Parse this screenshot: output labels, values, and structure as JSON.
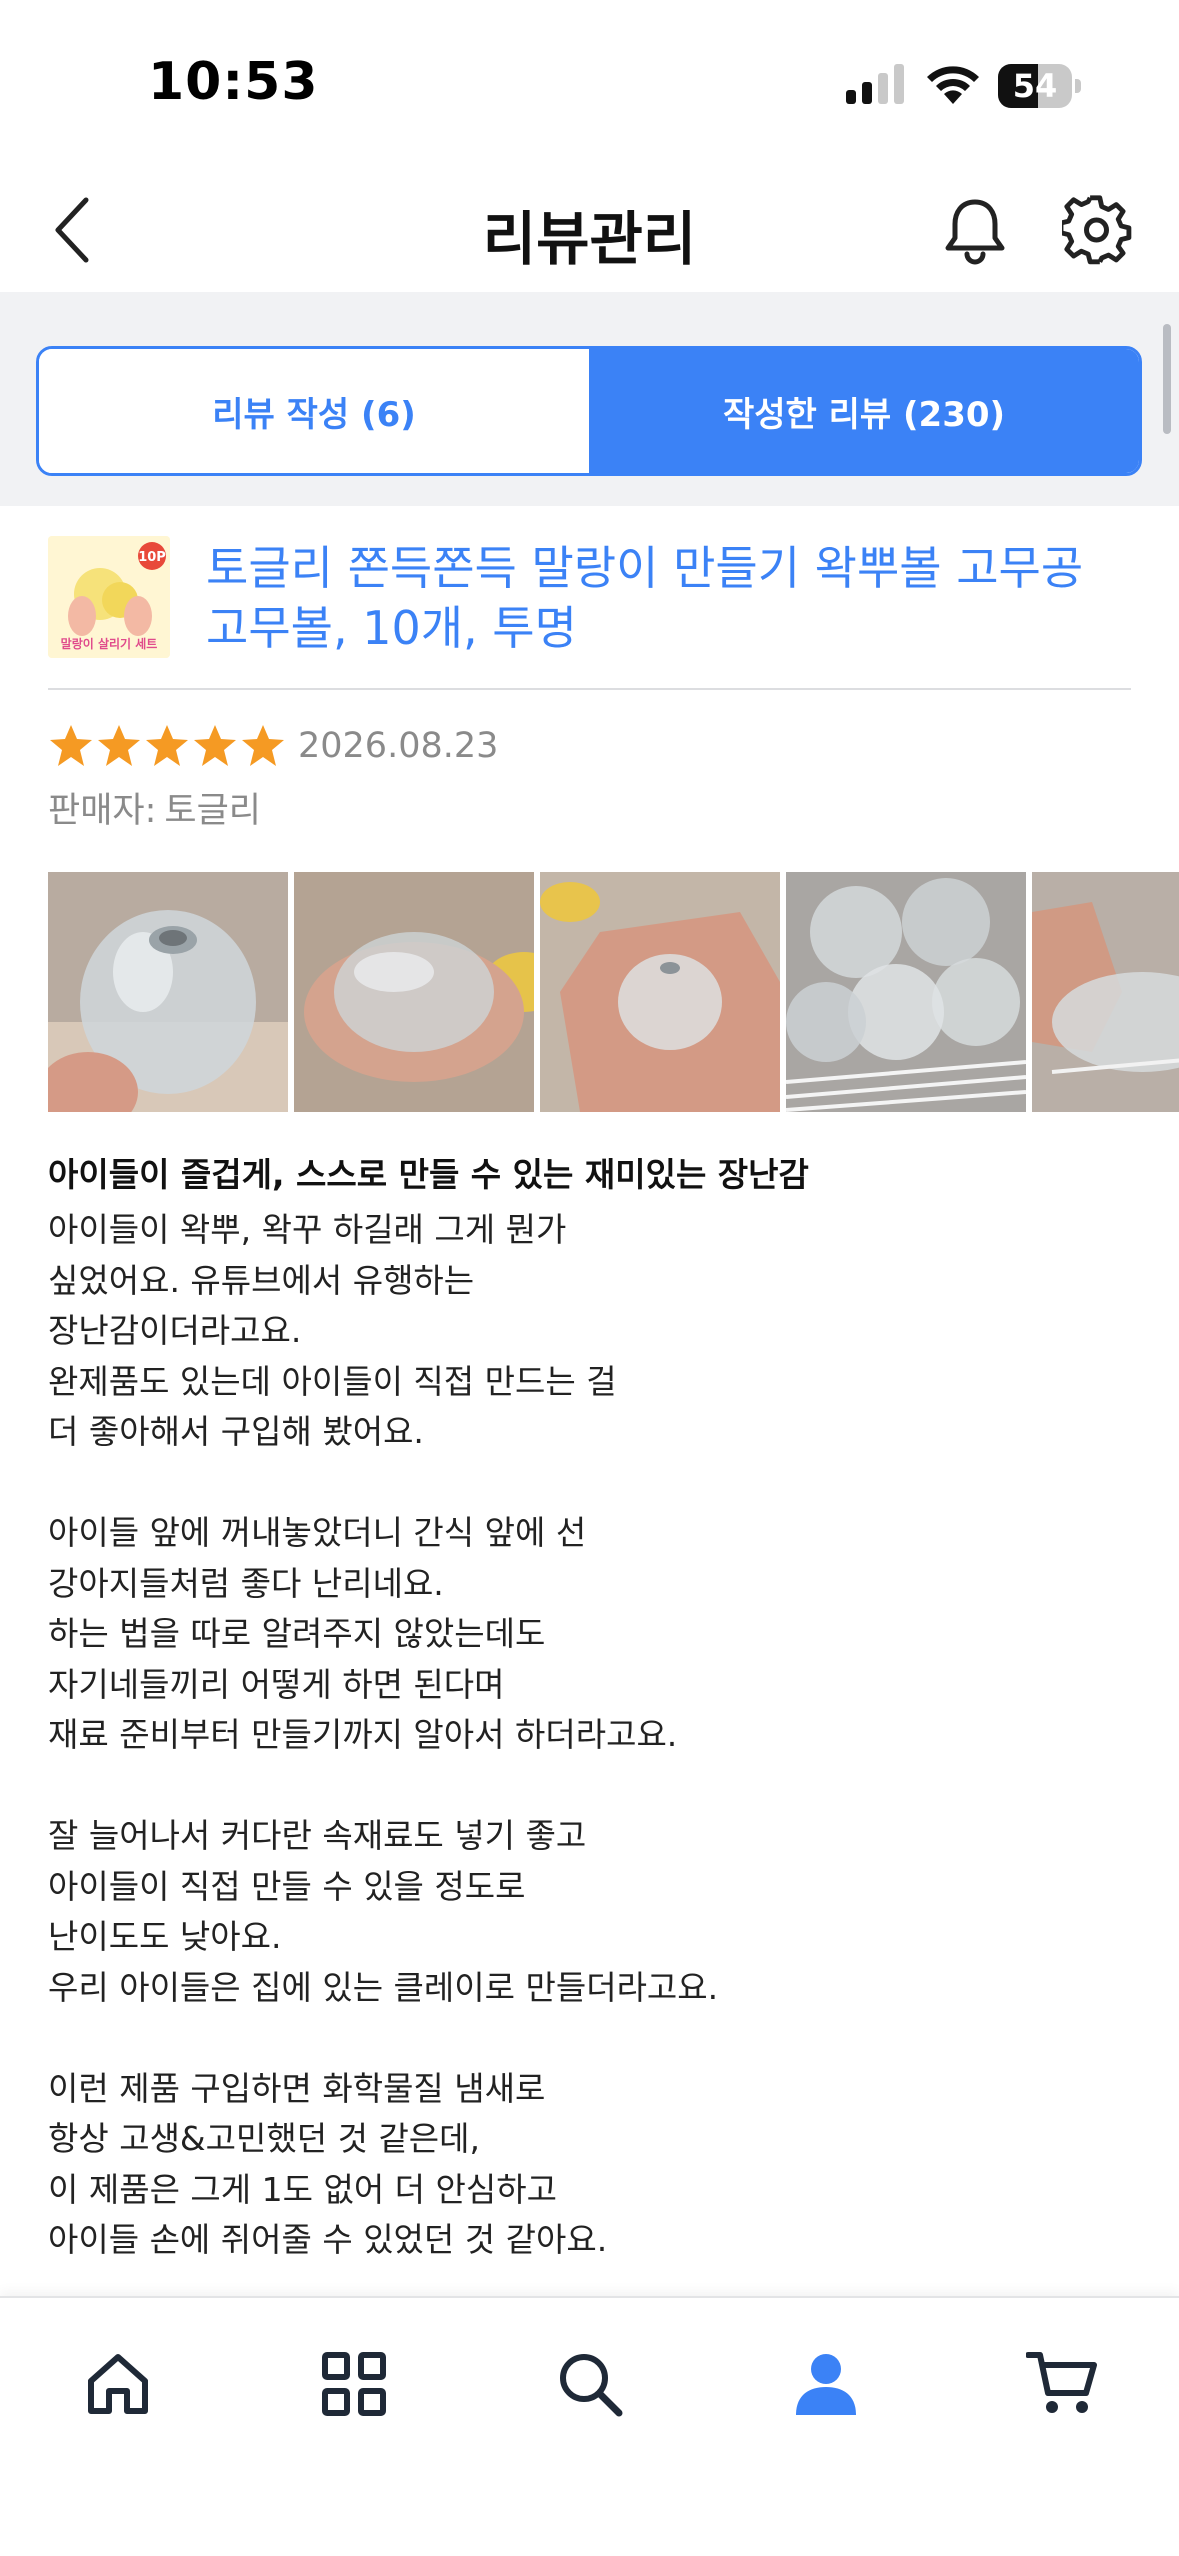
{
  "status_bar": {
    "time": "10:53",
    "battery": "54",
    "battery_level": 0.54
  },
  "header": {
    "title": "리뷰관리"
  },
  "tabs": [
    {
      "label": "리뷰 작성 (6)",
      "active": false
    },
    {
      "label": "작성한 리뷰 (230)",
      "active": true
    }
  ],
  "product": {
    "name": "토글리 쫀득쫀득 말랑이 만들기 왁뿌볼 고무공 고무볼, 10개, 투명",
    "thumb_badge": "10P",
    "thumb_caption": "말랑이 살리기 세트"
  },
  "review": {
    "rating": 5,
    "max_rating": 5,
    "date": "2026.08.23",
    "seller_label": "판매자:",
    "seller_name": "토글리",
    "photo_count": 5,
    "title": "아이들이 즐겁게, 스스로 만들 수 있는 재미있는 장난감",
    "lines": [
      "아이들이 왁뿌, 왁꾸 하길래 그게 뭔가",
      "싶었어요. 유튜브에서 유행하는",
      "장난감이더라고요.",
      "완제품도 있는데 아이들이 직접 만드는 걸",
      "더 좋아해서 구입해 봤어요.",
      "",
      "아이들 앞에 꺼내놓았더니 간식 앞에 선",
      "강아지들처럼 좋다 난리네요.",
      "하는 법을 따로 알려주지 않았는데도",
      "자기네들끼리 어떻게 하면 된다며",
      "재료 준비부터 만들기까지 알아서 하더라고요.",
      "",
      "잘 늘어나서 커다란 속재료도 넣기 좋고",
      "아이들이 직접 만들 수 있을 정도로",
      "난이도도 낮아요.",
      "우리 아이들은 집에 있는 클레이로 만들더라고요.",
      "",
      "이런 제품 구입하면 화학물질 냄새로",
      "항상 고생&고민했던 것 같은데,",
      "이 제품은 그게 1도 없어 더 안심하고",
      "아이들 손에 쥐어줄 수 있었던 것 같아요."
    ]
  },
  "bottom_nav": [
    {
      "icon": "home-icon",
      "active": false
    },
    {
      "icon": "grid-icon",
      "active": false
    },
    {
      "icon": "search-icon",
      "active": false
    },
    {
      "icon": "user-icon",
      "active": true
    },
    {
      "icon": "cart-icon",
      "active": false
    }
  ],
  "colors": {
    "accent": "#3b82f6",
    "star": "#f59a23",
    "muted": "#8a8a8a",
    "tab_bg": "#f1f2f4"
  }
}
